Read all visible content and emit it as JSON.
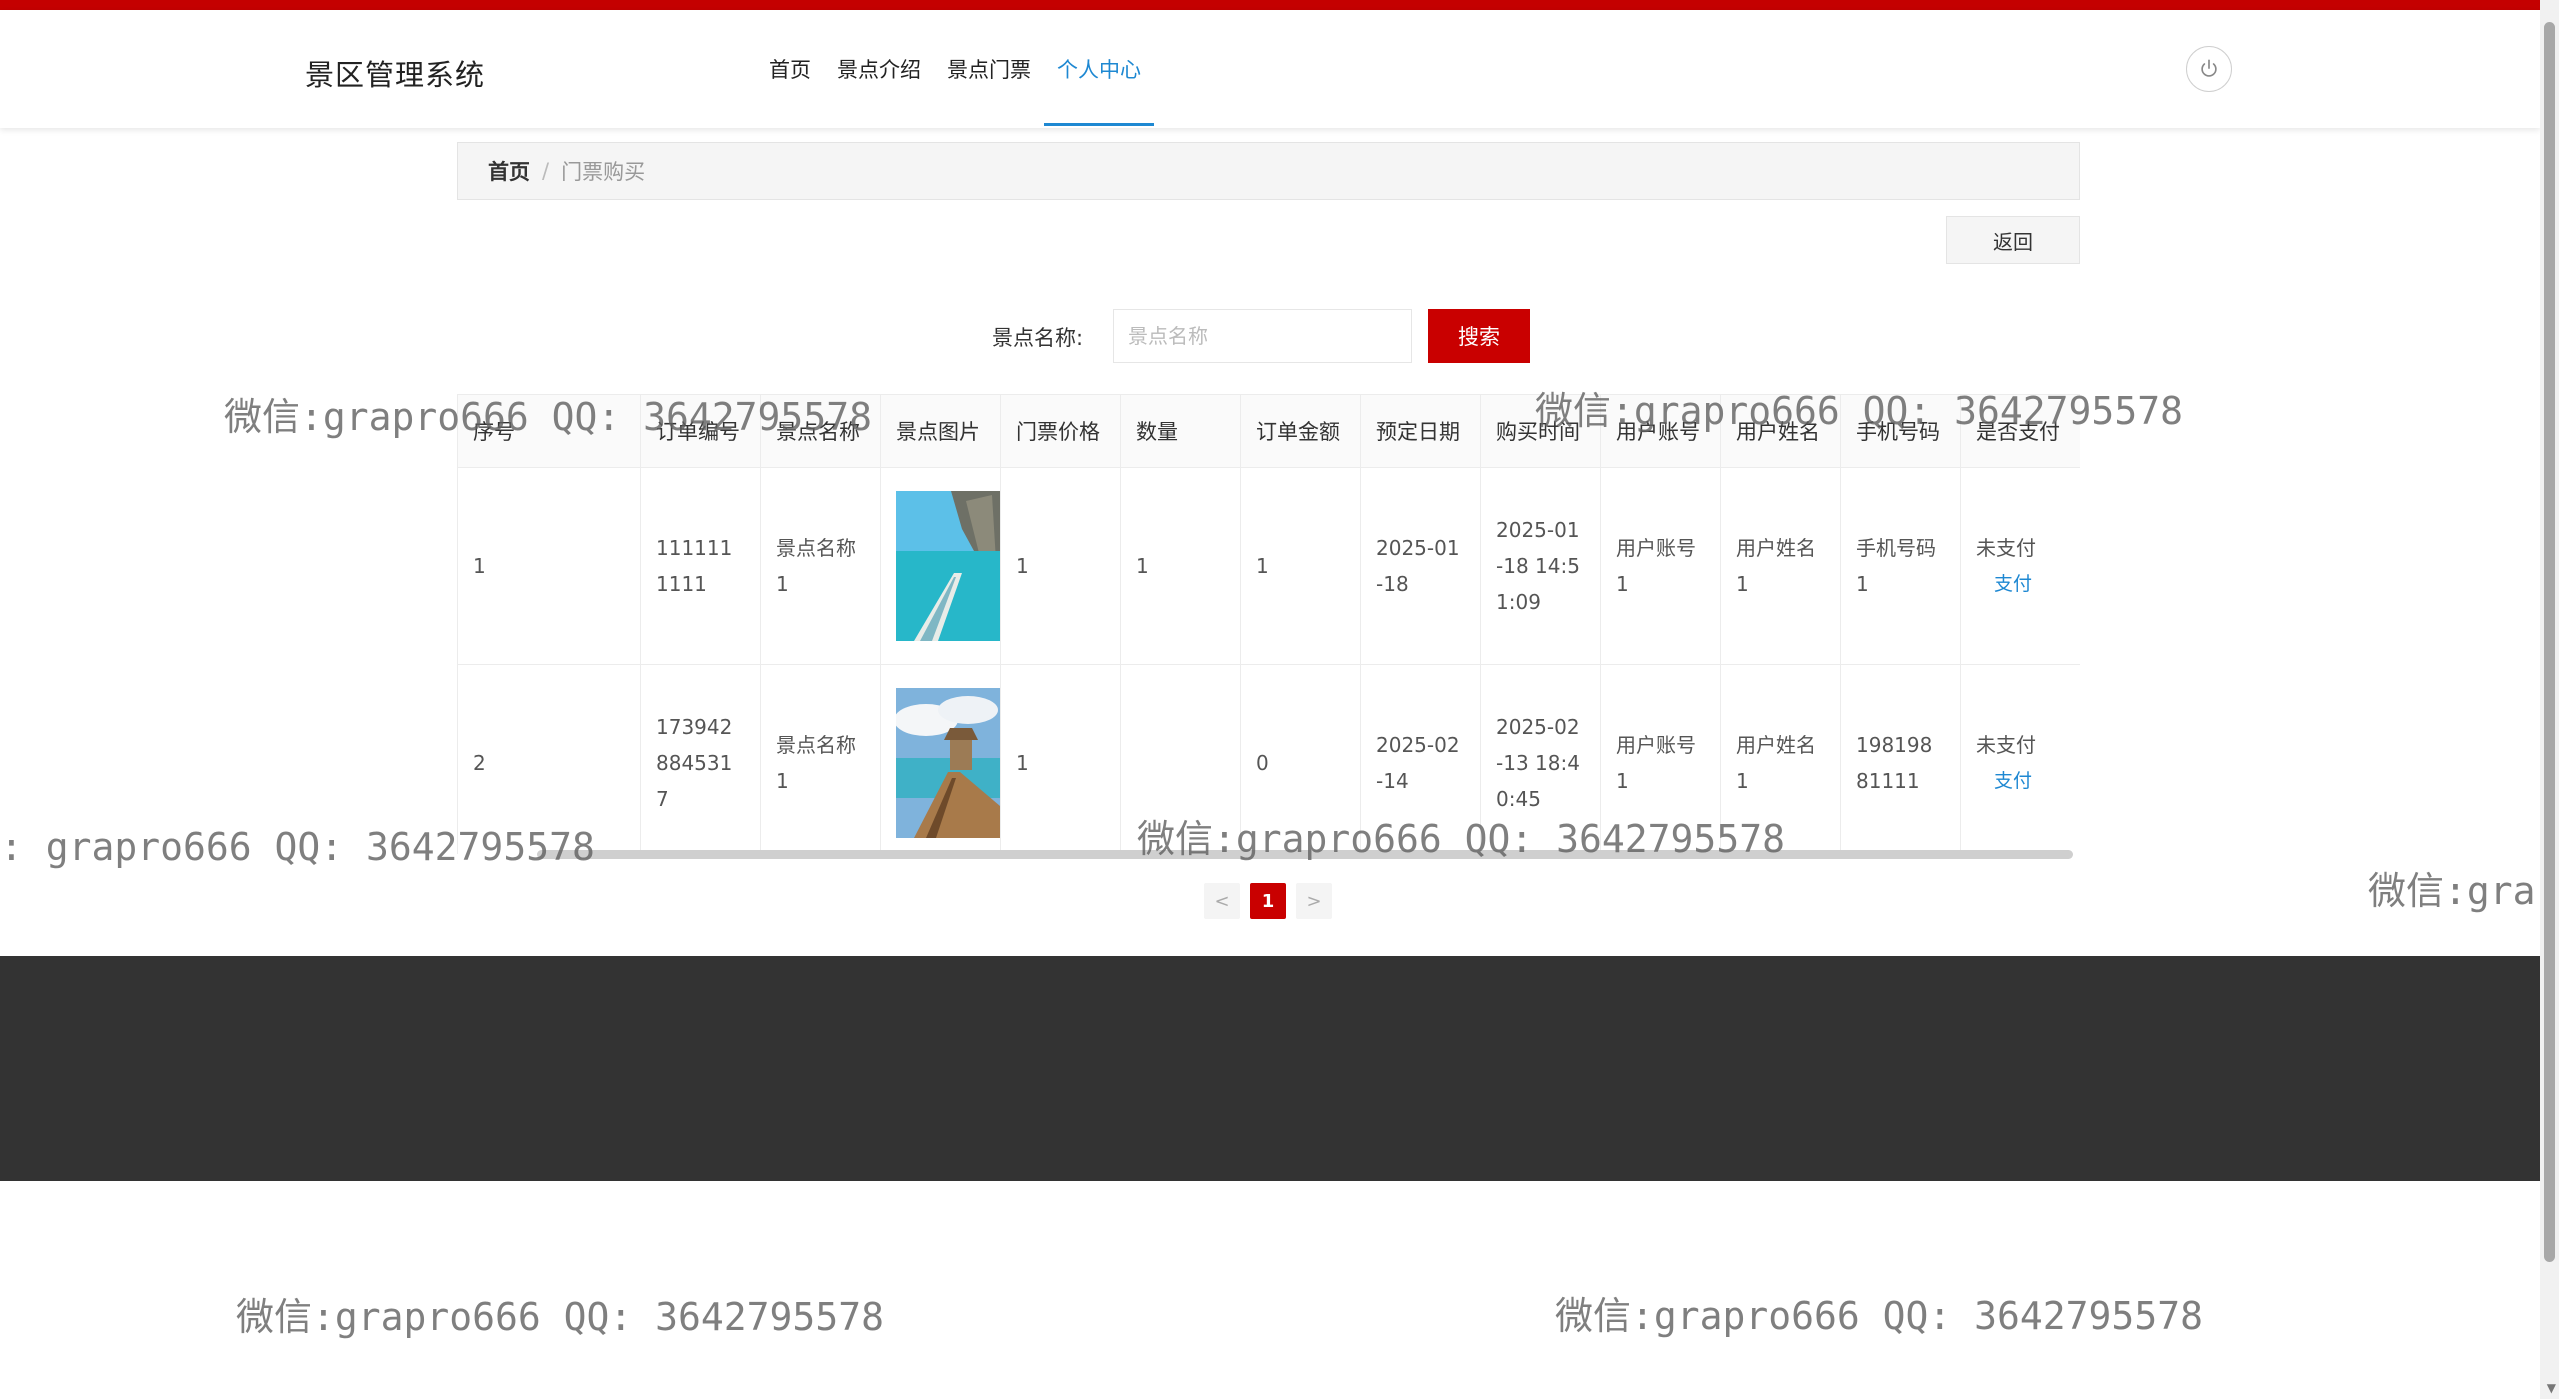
{
  "header": {
    "brand": "景区管理系统",
    "nav": [
      "首页",
      "景点介绍",
      "景点门票",
      "个人中心"
    ],
    "active_nav": "个人中心"
  },
  "breadcrumb": {
    "home": "首页",
    "separator": "/",
    "current": "门票购买"
  },
  "toolbar": {
    "back_label": "返回"
  },
  "search": {
    "label": "景点名称:",
    "placeholder": "景点名称",
    "button": "搜索"
  },
  "table": {
    "headers": [
      "序号",
      "订单编号",
      "景点名称",
      "景点图片",
      "门票价格",
      "数量",
      "订单金额",
      "预定日期",
      "购买时间",
      "用户账号",
      "用户姓名",
      "手机号码",
      "是否支付"
    ],
    "rows": [
      {
        "index": "1",
        "order_no": "1111111111",
        "spot_name": "景点名称1",
        "image": "tropical-coast-boat-photo",
        "price": "1",
        "quantity": "1",
        "amount": "1",
        "reserve_date": "2025-01-18",
        "purchase_time": "2025-01-18 14:51:09",
        "account": "用户账号1",
        "user_name": "用户姓名1",
        "phone": "手机号码1",
        "paid_status": "未支付",
        "pay_action": "支付"
      },
      {
        "index": "2",
        "order_no": "1739428845317",
        "spot_name": "景点名称1",
        "image": "seaside-pier-hut-photo",
        "price": "1",
        "quantity": "",
        "amount": "0",
        "reserve_date": "2025-02-14",
        "purchase_time": "2025-02-13 18:40:45",
        "account": "用户账号1",
        "user_name": "用户姓名1",
        "phone": "19819881111",
        "paid_status": "未支付",
        "pay_action": "支付"
      }
    ]
  },
  "pagination": {
    "prev": "<",
    "current": "1",
    "next": ">"
  },
  "watermarks": [
    "微信:grapro666 QQ: 3642795578",
    "微信:grapro666 QQ: 3642795578",
    ": grapro666 QQ: 3642795578",
    "微信:grapro666 QQ: 3642795578",
    "微信:gra",
    "微信:grapro666 QQ: 3642795578",
    "微信:grapro666 QQ: 3642795578"
  ],
  "colors": {
    "accent_red": "#c90000",
    "active_blue": "#1e88d2",
    "footer_bg": "#333333"
  }
}
